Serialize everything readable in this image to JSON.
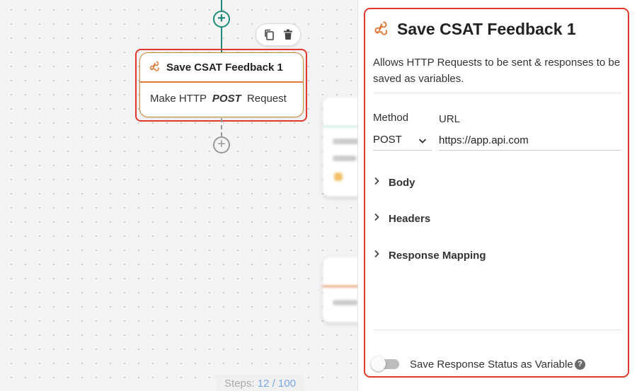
{
  "canvas": {
    "node": {
      "title": "Save CSAT Feedback 1",
      "body_prefix": "Make HTTP",
      "body_method": "POST",
      "body_suffix": "Request"
    },
    "steps": {
      "label": "Steps:",
      "count": "12 / 100"
    }
  },
  "panel": {
    "title": "Save CSAT Feedback 1",
    "description": "Allows HTTP Requests to be sent & responses to be saved as variables.",
    "method_label": "Method",
    "method_value": "POST",
    "url_label": "URL",
    "url_value": "https://app.api.com",
    "sections": [
      "Body",
      "Headers",
      "Response Mapping"
    ],
    "toggle_label": "Save Response Status as Variable",
    "toggle_on": false,
    "help_glyph": "?"
  },
  "colors": {
    "accent_teal": "#1f8a7a",
    "selection_red": "#e0392b",
    "node_orange": "#e07a3b"
  },
  "icons": [
    "plus-icon",
    "copy-icon",
    "trash-icon",
    "webhook-icon",
    "chevron-down-icon",
    "chevron-right-icon",
    "help-icon"
  ]
}
